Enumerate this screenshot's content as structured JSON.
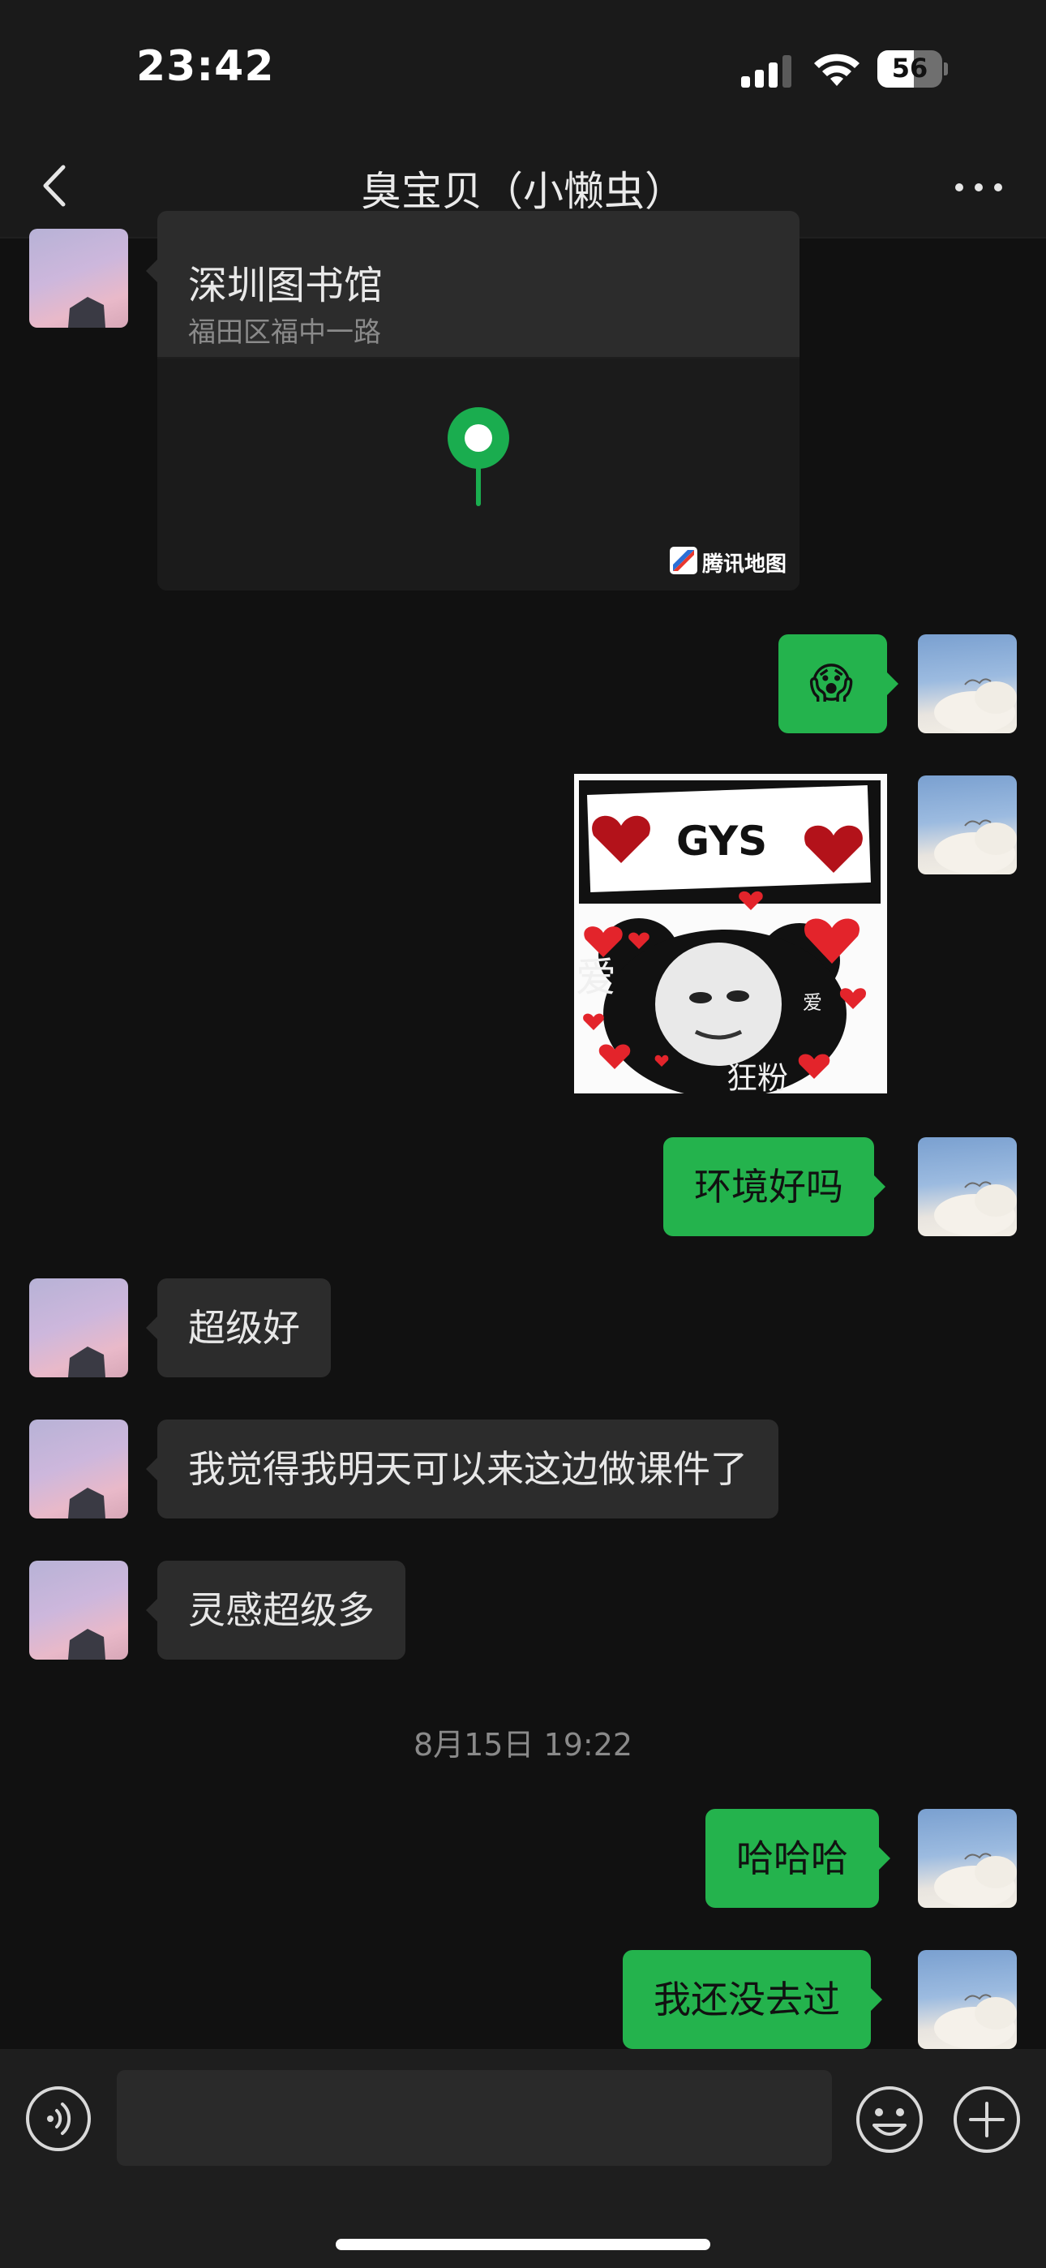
{
  "status_bar": {
    "time": "23:42",
    "battery_level": "56",
    "battery_fraction": 0.56
  },
  "header": {
    "title": "臭宝贝（小懒虫）",
    "back_icon": "chevron-left-icon",
    "more_icon": "ellipsis-icon"
  },
  "messages": {
    "location": {
      "name": "深圳图书馆",
      "address": "福田区福中一路",
      "map_provider": "腾讯地图",
      "pin_color": "#1aad4f"
    },
    "emoji_reply": "😱",
    "sticker": {
      "top_text": "GYS",
      "left_text": "爱",
      "right_text": "爱",
      "bottom_text": "狂粉"
    },
    "me_1": "环境好吗",
    "them_1": "超级好",
    "them_2": "我觉得我明天可以来这边做课件了",
    "them_3": "灵感超级多",
    "timestamp": "8月15日 19:22",
    "me_2": "哈哈哈",
    "me_3": "我还没去过"
  },
  "input_bar": {
    "placeholder": "",
    "voice_icon": "voice-icon",
    "emoji_icon": "smiley-icon",
    "plus_icon": "plus-icon"
  },
  "colors": {
    "background": "#111111",
    "bubble_me": "#24b34d",
    "bubble_them": "#2c2c2c",
    "accent_green": "#1aad4f"
  }
}
